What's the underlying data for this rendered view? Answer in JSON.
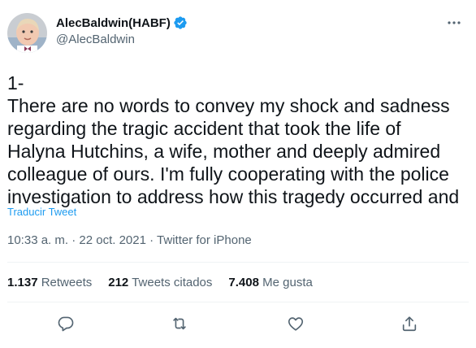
{
  "user": {
    "display_name": "AlecBaldwin(HABF)",
    "handle": "@AlecBaldwin",
    "verified": true,
    "avatar_icon": "profile-photo-baby"
  },
  "tweet": {
    "lines": [
      "1-",
      "There are no words to convey my shock and sadness",
      "regarding the tragic accident that took the life of",
      "Halyna Hutchins, a wife, mother and deeply admired",
      "colleague of ours. I'm fully cooperating with the police",
      "investigation to address how this tragedy occurred and"
    ],
    "translate_label": "Traducir Tweet",
    "time": "10:33 a. m.",
    "separator": " · ",
    "date": "22 oct. 2021",
    "source": "Twitter for iPhone"
  },
  "stats": [
    {
      "count": "1.137",
      "label": "Retweets"
    },
    {
      "count": "212",
      "label": "Tweets citados"
    },
    {
      "count": "7.408",
      "label": "Me gusta"
    }
  ],
  "actions": [
    "reply-icon",
    "retweet-icon",
    "like-icon",
    "share-icon"
  ],
  "colors": {
    "text": "#0f1419",
    "secondary": "#536471",
    "link": "#1d9bf0",
    "divider": "#eff3f4"
  }
}
